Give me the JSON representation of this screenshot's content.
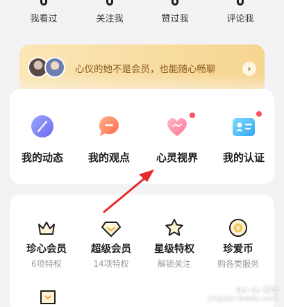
{
  "stats": [
    {
      "label": "我看过"
    },
    {
      "label": "关注我"
    },
    {
      "label": "赞过我"
    },
    {
      "label": "评论我"
    }
  ],
  "vip_banner": {
    "text": "心仪的她不是会员，也能随心畅聊",
    "arrow": "›"
  },
  "features": [
    {
      "label": "我的动态",
      "icon": "feather-icon",
      "badge": false
    },
    {
      "label": "我的观点",
      "icon": "speech-bubble-icon",
      "badge": false
    },
    {
      "label": "心灵视界",
      "icon": "heart-icon",
      "badge": true
    },
    {
      "label": "我的认证",
      "icon": "id-card-icon",
      "badge": true
    }
  ],
  "services": [
    {
      "label": "珍心会员",
      "sub": "6项特权",
      "icon": "crown-icon"
    },
    {
      "label": "超级会员",
      "sub": "14项特权",
      "icon": "diamond-icon"
    },
    {
      "label": "星级特权",
      "sub": "解锁关注",
      "icon": "star-icon"
    },
    {
      "label": "珍爱币",
      "sub": "购各类服务",
      "icon": "coin-icon"
    }
  ],
  "watermark": {
    "line1": "Bai du 经验",
    "line2": "jingyan.baidu.com"
  },
  "colors": {
    "accent_red": "#ff4d5e",
    "banner_text": "#8a5a1e",
    "arrow_red": "#e8282b"
  }
}
